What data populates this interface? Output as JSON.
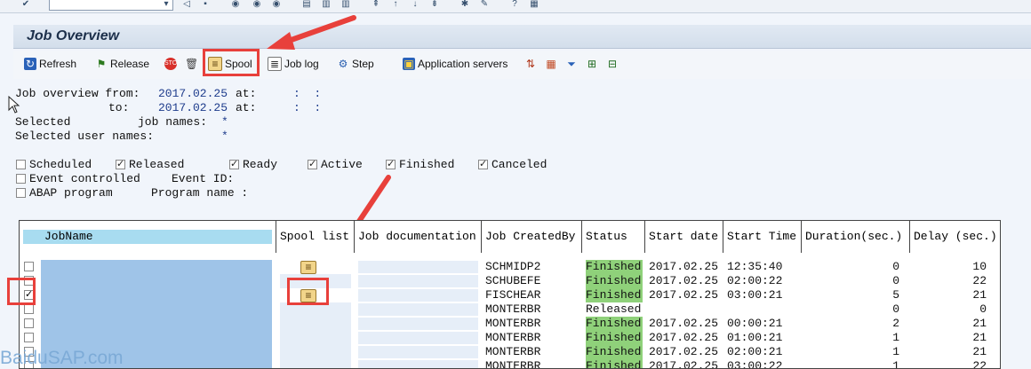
{
  "title": "Job Overview",
  "toolbar": {
    "refresh": "Refresh",
    "release": "Release",
    "spool": "Spool",
    "joblog": "Job log",
    "step": "Step",
    "appservers": "Application servers"
  },
  "info": {
    "from_label": "Job overview from:",
    "from_date": "2017.02.25",
    "at1": "at:",
    "time1": ":  :",
    "to_label": "to:",
    "to_date": "2017.02.25",
    "at2": "at:",
    "time2": ":  :",
    "selected_label": "Selected",
    "jobnames_label": "job names:",
    "jobnames_value": "*",
    "users_label": "Selected user names:",
    "users_value": "*"
  },
  "filters": {
    "scheduled": {
      "label": "Scheduled",
      "checked": false
    },
    "released": {
      "label": "Released",
      "checked": true
    },
    "ready": {
      "label": "Ready",
      "checked": true
    },
    "active": {
      "label": "Active",
      "checked": true
    },
    "finished": {
      "label": "Finished",
      "checked": true
    },
    "canceled": {
      "label": "Canceled",
      "checked": true
    },
    "event": {
      "label": "Event controlled",
      "checked": false
    },
    "eventid": "Event ID:",
    "abap": {
      "label": "ABAP program",
      "checked": false
    },
    "progname": "Program name :"
  },
  "table": {
    "headers": [
      "JobName",
      "Spool list",
      "Job documentation",
      "Job CreatedBy",
      "Status",
      "Start date",
      "Start Time",
      "Duration(sec.)",
      "Delay (sec.)"
    ],
    "rows": [
      {
        "selected": false,
        "spool": true,
        "createdby": "SCHMIDP2",
        "status": "Finished",
        "date": "2017.02.25",
        "time": "12:35:40",
        "duration": "0",
        "delay": "10"
      },
      {
        "selected": false,
        "spool": false,
        "createdby": "SCHUBEFE",
        "status": "Finished",
        "date": "2017.02.25",
        "time": "02:00:22",
        "duration": "0",
        "delay": "22"
      },
      {
        "selected": true,
        "spool": true,
        "createdby": "FISCHEAR",
        "status": "Finished",
        "date": "2017.02.25",
        "time": "03:00:21",
        "duration": "5",
        "delay": "21"
      },
      {
        "selected": false,
        "spool": false,
        "createdby": "MONTERBR",
        "status": "Released",
        "date": "",
        "time": "",
        "duration": "0",
        "delay": "0"
      },
      {
        "selected": false,
        "spool": false,
        "createdby": "MONTERBR",
        "status": "Finished",
        "date": "2017.02.25",
        "time": "00:00:21",
        "duration": "2",
        "delay": "21"
      },
      {
        "selected": false,
        "spool": false,
        "createdby": "MONTERBR",
        "status": "Finished",
        "date": "2017.02.25",
        "time": "01:00:21",
        "duration": "1",
        "delay": "21"
      },
      {
        "selected": false,
        "spool": false,
        "createdby": "MONTERBR",
        "status": "Finished",
        "date": "2017.02.25",
        "time": "02:00:21",
        "duration": "1",
        "delay": "21"
      },
      {
        "selected": false,
        "spool": false,
        "createdby": "MONTERBR",
        "status": "Finished",
        "date": "2017.02.25",
        "time": "03:00:22",
        "duration": "1",
        "delay": "22"
      }
    ]
  },
  "watermark": "BaiduSAP.com",
  "colors": {
    "finished": "#8fd17a",
    "annotation": "#e8403b",
    "header": "#a8dcf0"
  }
}
